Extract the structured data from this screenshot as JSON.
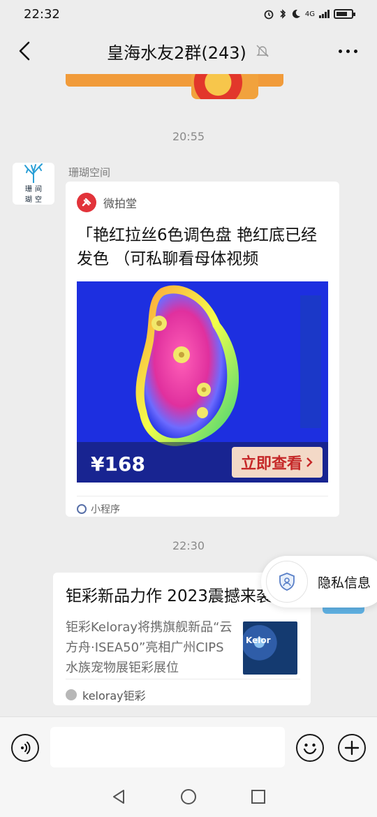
{
  "status_bar": {
    "time": "22:32",
    "network": "4G",
    "icons": [
      "alarm-icon",
      "bluetooth-icon",
      "moon-icon",
      "signal-icon",
      "battery-icon"
    ]
  },
  "header": {
    "title": "皇海水友2群(243)",
    "icons": [
      "back-arrow-icon",
      "mute-bell-icon",
      "more-dots-icon"
    ]
  },
  "chat": {
    "timestamps": [
      "20:55",
      "22:30"
    ],
    "coral_message": {
      "sender": "珊瑚空间",
      "avatar_text": [
        "珊",
        "间",
        "瑚",
        "空"
      ],
      "mini_program": {
        "source": "微拍堂",
        "title": "「艳红拉丝6色调色盘 艳红底已经发色 （可私聊看母体视频",
        "price": "¥168",
        "cta": "立即查看",
        "footer": "小程序"
      }
    },
    "my_message": {
      "article": {
        "title": "钜彩新品力作 2023震撼来袭",
        "description": "钜彩Keloray将携旗舰新品“云方舟·ISEA50”亮相广州CIPS水族宠物展钜彩展位",
        "thumb_text": "Kelor",
        "source": "keloray钜彩"
      }
    }
  },
  "privacy_popup": {
    "label": "隐私信息"
  },
  "input_bar": {
    "value": "",
    "placeholder": "",
    "icons": [
      "voice-icon",
      "emoji-icon",
      "plus-icon"
    ]
  },
  "system_nav": {
    "icons": [
      "back-triangle-icon",
      "home-circle-icon",
      "recents-square-icon"
    ]
  },
  "colors": {
    "background": "#ededed",
    "accent_red": "#e2333a",
    "cta_text": "#c52828"
  }
}
